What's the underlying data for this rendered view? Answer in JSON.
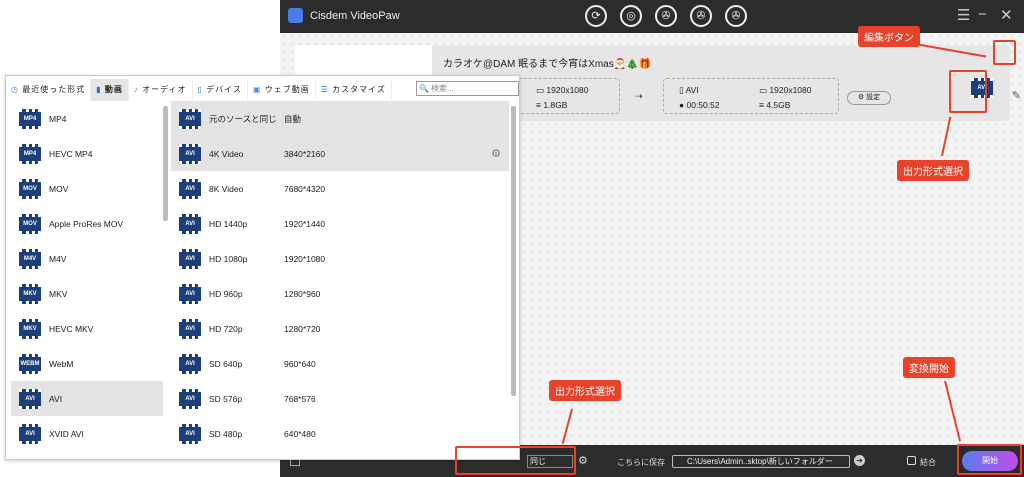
{
  "app": {
    "title": "Cisdem VideoPaw",
    "menu_icon": "hamburger-icon",
    "nav_icons": [
      "convert-icon",
      "rip-icon",
      "film-icon",
      "film-edit-icon",
      "film-compress-icon"
    ]
  },
  "file": {
    "name": "カラオケ@DAM 眠るまで今宵はXmas🎅🎄🎁",
    "source": {
      "resolution": "1920x1080",
      "size": "1.8GB"
    },
    "output": {
      "format": "AVI",
      "resolution": "1920x1080",
      "duration": "00:50:52",
      "size": "4.5GB"
    },
    "settings_label": "⚙ 設定",
    "format_badge": "AVI"
  },
  "popup": {
    "tabs": [
      "最近使った形式",
      "動画",
      "オーディオ",
      "デバイス",
      "ウェブ動画",
      "カスタマイズ"
    ],
    "active_tab": 1,
    "search_placeholder": "検索...",
    "formats": [
      {
        "label": "MP4",
        "badge": "MP4"
      },
      {
        "label": "HEVC MP4",
        "badge": "MP4"
      },
      {
        "label": "MOV",
        "badge": "MOV"
      },
      {
        "label": "Apple ProRes MOV",
        "badge": "MOV"
      },
      {
        "label": "M4V",
        "badge": "M4V"
      },
      {
        "label": "MKV",
        "badge": "MKV"
      },
      {
        "label": "HEVC MKV",
        "badge": "MKV"
      },
      {
        "label": "WebM",
        "badge": "WEBM"
      },
      {
        "label": "AVI",
        "badge": "AVI"
      },
      {
        "label": "XVID AVI",
        "badge": "AVI"
      }
    ],
    "selected_format": 8,
    "presets": [
      {
        "name": "元のソースと同じ",
        "res": "自動"
      },
      {
        "name": "4K Video",
        "res": "3840*2160"
      },
      {
        "name": "8K Video",
        "res": "7680*4320"
      },
      {
        "name": "HD 1440p",
        "res": "1920*1440"
      },
      {
        "name": "HD 1080p",
        "res": "1920*1080"
      },
      {
        "name": "HD 960p",
        "res": "1280*960"
      },
      {
        "name": "HD 720p",
        "res": "1280*720"
      },
      {
        "name": "SD 640p",
        "res": "960*640"
      },
      {
        "name": "SD 576p",
        "res": "768*576"
      },
      {
        "name": "SD 480p",
        "res": "640*480"
      }
    ],
    "preset_badge": "AVI"
  },
  "bottom": {
    "format_select": "同じ",
    "save_label": "こちらに保存",
    "path": "C:\\Users\\Admin..sktop\\新しいフォルダー",
    "merge_label": "結合",
    "start_label": "開始"
  },
  "annotations": {
    "edit": "編集ボタン",
    "format_top": "出力形式選択",
    "format_bottom": "出力形式選択",
    "start": "変換開始"
  },
  "colors": {
    "accent": "#e8432a",
    "titlebar": "#2c2c2c"
  }
}
